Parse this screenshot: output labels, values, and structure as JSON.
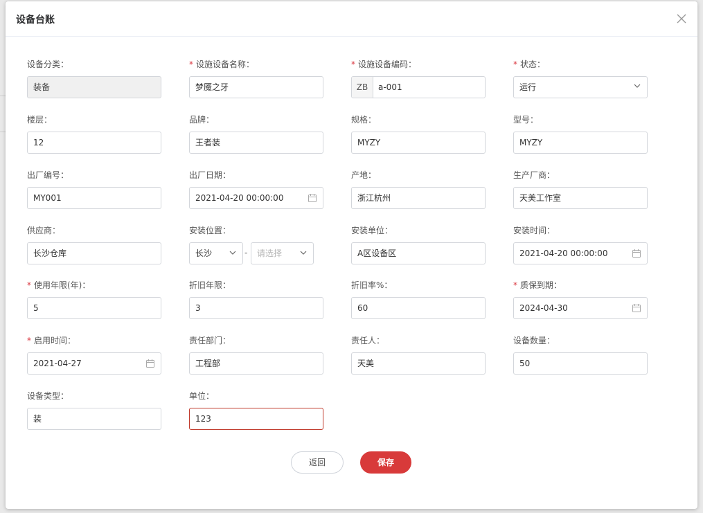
{
  "dialog": {
    "title": "设备台账"
  },
  "fields": {
    "category": {
      "label": "设备分类：",
      "value": "装备",
      "required": false
    },
    "name": {
      "label": "设施设备名称：",
      "value": "梦魇之牙",
      "required": true
    },
    "code": {
      "label": "设施设备编码：",
      "prefix": "ZB",
      "value": "a-001",
      "required": true
    },
    "status": {
      "label": "状态：",
      "value": "运行",
      "required": true
    },
    "floor": {
      "label": "楼层：",
      "value": "12"
    },
    "brand": {
      "label": "品牌：",
      "value": "王者装"
    },
    "spec": {
      "label": "规格：",
      "value": "MYZY"
    },
    "model": {
      "label": "型号：",
      "value": "MYZY"
    },
    "serial": {
      "label": "出厂编号：",
      "value": "MY001"
    },
    "mfg_date": {
      "label": "出厂日期：",
      "value": "2021-04-20 00:00:00"
    },
    "origin": {
      "label": "产地：",
      "value": "浙江杭州"
    },
    "manufacturer": {
      "label": "生产厂商：",
      "value": "天美工作室"
    },
    "supplier": {
      "label": "供应商：",
      "value": "长沙仓库"
    },
    "location": {
      "label": "安装位置：",
      "value1": "长沙",
      "separator": "-",
      "placeholder2": "请选择"
    },
    "install_unit": {
      "label": "安装单位：",
      "value": "A区设备区"
    },
    "install_time": {
      "label": "安装时间：",
      "value": "2021-04-20 00:00:00"
    },
    "life_years": {
      "label": "使用年限(年)：",
      "value": "5",
      "required": true
    },
    "dep_years": {
      "label": "折旧年限：",
      "value": "3"
    },
    "dep_rate": {
      "label": "折旧率%：",
      "value": "60"
    },
    "warranty": {
      "label": "质保到期：",
      "value": "2024-04-30",
      "required": true
    },
    "start_time": {
      "label": "启用时间：",
      "value": "2021-04-27",
      "required": true
    },
    "department": {
      "label": "责任部门：",
      "value": "工程部"
    },
    "owner": {
      "label": "责任人：",
      "value": "天美"
    },
    "quantity": {
      "label": "设备数量：",
      "value": "50"
    },
    "type": {
      "label": "设备类型：",
      "value": "装"
    },
    "unit": {
      "label": "单位：",
      "value": "123"
    }
  },
  "buttons": {
    "back": "返回",
    "save": "保存"
  },
  "colors": {
    "accent": "#d83a3a",
    "required": "#d9363e",
    "error_border": "#c0392b"
  }
}
